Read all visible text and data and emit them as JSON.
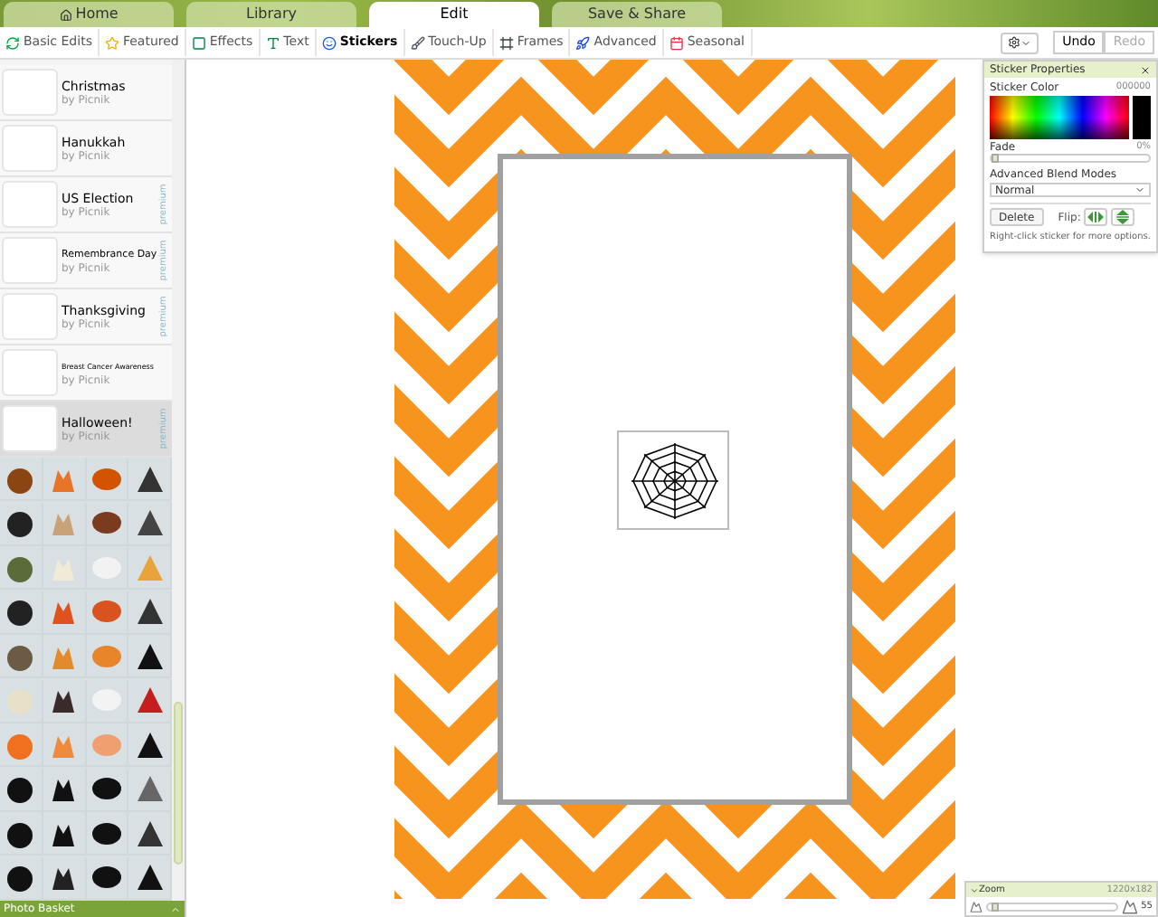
{
  "top_tabs": [
    {
      "label": "Home",
      "selected": false
    },
    {
      "label": "Library",
      "selected": false
    },
    {
      "label": "Edit",
      "selected": true
    },
    {
      "label": "Save & Share",
      "selected": false
    }
  ],
  "toolbar": {
    "tools": [
      {
        "label": "Basic Edits",
        "selected": false
      },
      {
        "label": "Featured",
        "selected": false
      },
      {
        "label": "Effects",
        "selected": false
      },
      {
        "label": "Text",
        "selected": false
      },
      {
        "label": "Stickers",
        "selected": true
      },
      {
        "label": "Touch-Up",
        "selected": false
      },
      {
        "label": "Frames",
        "selected": false
      },
      {
        "label": "Advanced",
        "selected": false
      },
      {
        "label": "Seasonal",
        "selected": false
      }
    ],
    "undo": {
      "label": "Undo",
      "disabled": false
    },
    "redo": {
      "label": "Redo",
      "disabled": true
    }
  },
  "sticker_sets": [
    {
      "name": "Christmas",
      "author": "by Picnik",
      "selected": false
    },
    {
      "name": "Hanukkah",
      "author": "by Picnik",
      "selected": false
    },
    {
      "name": "US Election",
      "author": "by Picnik",
      "badge": "premium",
      "selected": false
    },
    {
      "name": "Remembrance Day",
      "author": "by Picnik",
      "badge": "premium",
      "selected": false
    },
    {
      "name": "Thanksgiving",
      "author": "by Picnik",
      "badge": "premium",
      "selected": false
    },
    {
      "name": "Breast Cancer Awareness",
      "author": "by Picnik",
      "selected": false
    },
    {
      "name": "Halloween!",
      "author": "by Picnik",
      "badge": "premium",
      "selected": true
    }
  ],
  "photo_basket": "Photo Basket",
  "sticker_properties": {
    "title": "Sticker Properties",
    "color_label": "Sticker Color",
    "color_value": "000000",
    "fade_label": "Fade",
    "fade": {
      "level": 0
    },
    "fade_reading": "0%",
    "blend_label": "Advanced Blend Modes",
    "blend_value": "Normal",
    "delete": "Delete",
    "flip_label": "Flip:",
    "hint": "Right-click sticker for more options."
  },
  "zoom": {
    "title": "Zoom",
    "dimensions": "1220x182",
    "level": 0.03,
    "reading": "55"
  }
}
